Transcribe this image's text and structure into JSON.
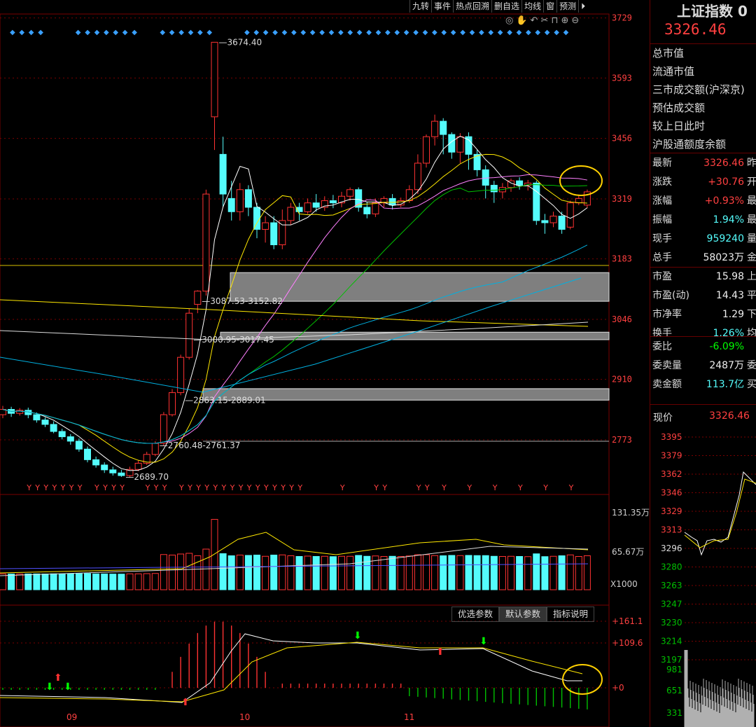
{
  "toolbar": [
    "九转",
    "事件",
    "热点回溯",
    "删自选",
    "均线",
    "窗",
    "预测"
  ],
  "panel": {
    "title": "上证指数 0",
    "price": "3326.46",
    "labels": [
      "总市值",
      "流通市值",
      "三市成交额(沪深京)",
      "预估成交额",
      "较上日此时",
      "沪股通额度余额"
    ],
    "stats1": [
      {
        "l": "最新",
        "v": "3326.46",
        "c": "red",
        "s": "昨"
      },
      {
        "l": "涨跌",
        "v": "+30.76",
        "c": "red",
        "s": "开"
      },
      {
        "l": "涨幅",
        "v": "+0.93%",
        "c": "red",
        "s": "最"
      },
      {
        "l": "振幅",
        "v": "1.94%",
        "c": "cyan",
        "s": "最"
      },
      {
        "l": "现手",
        "v": "959240",
        "c": "cyan",
        "s": "量"
      },
      {
        "l": "总手",
        "v": "58023万",
        "c": "white",
        "s": "金"
      }
    ],
    "stats2": [
      {
        "l": "市盈",
        "v": "15.98",
        "c": "white",
        "s": "上"
      },
      {
        "l": "市盈(动)",
        "v": "14.43",
        "c": "white",
        "s": "平"
      },
      {
        "l": "市净率",
        "v": "1.29",
        "c": "white",
        "s": "下"
      },
      {
        "l": "换手",
        "v": "1.26%",
        "c": "cyan",
        "s": "均"
      }
    ],
    "stats3": [
      {
        "l": "委比",
        "v": "-6.09%",
        "c": "green",
        "s": ""
      },
      {
        "l": "委卖量",
        "v": "2487万",
        "c": "white",
        "s": "委"
      },
      {
        "l": "卖金额",
        "v": "113.7亿",
        "c": "cyan",
        "s": "买"
      }
    ],
    "cur_label": "现价",
    "cur_value": "3326.46"
  },
  "buttons": [
    "优选参数",
    "默认参数",
    "指标说明"
  ],
  "active_button": 1,
  "chart_data": [
    {
      "type": "candlestick",
      "y_ticks": [
        3729,
        3593,
        3456,
        3319,
        3183,
        3046,
        2910,
        2773
      ],
      "ylim": [
        2689,
        3729
      ],
      "candles": [
        [
          2830,
          2842,
          2850,
          2822
        ],
        [
          2842,
          2833,
          2848,
          2825
        ],
        [
          2833,
          2840,
          2845,
          2828
        ],
        [
          2840,
          2830,
          2846,
          2822
        ],
        [
          2830,
          2818,
          2835,
          2812
        ],
        [
          2818,
          2808,
          2824,
          2802
        ],
        [
          2808,
          2792,
          2815,
          2788
        ],
        [
          2792,
          2780,
          2798,
          2774
        ],
        [
          2780,
          2770,
          2786,
          2762
        ],
        [
          2770,
          2752,
          2776,
          2746
        ],
        [
          2752,
          2728,
          2758,
          2722
        ],
        [
          2728,
          2716,
          2735,
          2710
        ],
        [
          2716,
          2705,
          2722,
          2698
        ],
        [
          2705,
          2698,
          2712,
          2692
        ],
        [
          2698,
          2692,
          2705,
          2689
        ],
        [
          2692,
          2706,
          2712,
          2688
        ],
        [
          2706,
          2720,
          2726,
          2702
        ],
        [
          2720,
          2740,
          2746,
          2716
        ],
        [
          2740,
          2765,
          2770,
          2736
        ],
        [
          2765,
          2830,
          2836,
          2760
        ],
        [
          2830,
          2880,
          2888,
          2826
        ],
        [
          2880,
          2960,
          2966,
          2874
        ],
        [
          2960,
          3060,
          3070,
          2955
        ],
        [
          3080,
          3110,
          3112,
          3060
        ],
        [
          3110,
          3330,
          3340,
          3100
        ],
        [
          3505,
          3674,
          3674,
          3430
        ],
        [
          3420,
          3330,
          3460,
          3300
        ],
        [
          3320,
          3290,
          3360,
          3270
        ],
        [
          3290,
          3340,
          3355,
          3270
        ],
        [
          3340,
          3300,
          3350,
          3280
        ],
        [
          3300,
          3250,
          3310,
          3230
        ],
        [
          3250,
          3265,
          3280,
          3220
        ],
        [
          3265,
          3215,
          3280,
          3205
        ],
        [
          3215,
          3270,
          3295,
          3205
        ],
        [
          3270,
          3300,
          3310,
          3260
        ],
        [
          3300,
          3290,
          3310,
          3270
        ],
        [
          3290,
          3310,
          3320,
          3285
        ],
        [
          3310,
          3300,
          3330,
          3290
        ],
        [
          3300,
          3315,
          3325,
          3292
        ],
        [
          3315,
          3310,
          3328,
          3298
        ],
        [
          3310,
          3325,
          3335,
          3300
        ],
        [
          3325,
          3340,
          3345,
          3315
        ],
        [
          3340,
          3300,
          3345,
          3290
        ],
        [
          3300,
          3285,
          3312,
          3275
        ],
        [
          3285,
          3310,
          3320,
          3278
        ],
        [
          3310,
          3320,
          3325,
          3300
        ],
        [
          3320,
          3305,
          3330,
          3295
        ],
        [
          3305,
          3315,
          3322,
          3300
        ],
        [
          3315,
          3340,
          3350,
          3310
        ],
        [
          3340,
          3400,
          3420,
          3330
        ],
        [
          3400,
          3460,
          3465,
          3390
        ],
        [
          3460,
          3495,
          3510,
          3440
        ],
        [
          3495,
          3465,
          3502,
          3420
        ],
        [
          3465,
          3425,
          3470,
          3410
        ],
        [
          3425,
          3460,
          3468,
          3400
        ],
        [
          3460,
          3420,
          3470,
          3385
        ],
        [
          3420,
          3385,
          3430,
          3370
        ],
        [
          3385,
          3350,
          3395,
          3320
        ],
        [
          3350,
          3335,
          3360,
          3310
        ],
        [
          3335,
          3345,
          3355,
          3320
        ],
        [
          3345,
          3360,
          3365,
          3335
        ],
        [
          3360,
          3350,
          3368,
          3340
        ],
        [
          3350,
          3355,
          3362,
          3338
        ],
        [
          3355,
          3270,
          3360,
          3260
        ],
        [
          3270,
          3265,
          3285,
          3240
        ],
        [
          3265,
          3280,
          3290,
          3255
        ],
        [
          3280,
          3250,
          3290,
          3240
        ],
        [
          3255,
          3310,
          3315,
          3250
        ],
        [
          3310,
          3320,
          3328,
          3305
        ],
        [
          3305,
          3335,
          3340,
          3298
        ]
      ],
      "annotations": [
        {
          "text": "3674.40",
          "x": 25,
          "y": 3674
        },
        {
          "text": "3087.53-3152.82",
          "x": 23,
          "y": 3087
        },
        {
          "text": "3000.95-3017.45",
          "x": 22,
          "y": 3000
        },
        {
          "text": "2863.15-2889.01",
          "x": 21,
          "y": 2863
        },
        {
          "text": "2760.48-2761.37",
          "x": 18,
          "y": 2760
        },
        {
          "text": "2689.70",
          "x": 14,
          "y": 2689
        }
      ],
      "zones": [
        [
          3087,
          3152
        ],
        [
          3000,
          3017
        ],
        [
          2863,
          2889
        ]
      ],
      "hline": 3190
    },
    {
      "type": "bar",
      "y_ticks": [
        "131.35万",
        "65.67万",
        "X1000"
      ]
    },
    {
      "type": "macd",
      "y_ticks": [
        "+161.1",
        "+109.6",
        "+0"
      ],
      "x_ticks": [
        "09",
        "10",
        "11"
      ]
    }
  ]
}
